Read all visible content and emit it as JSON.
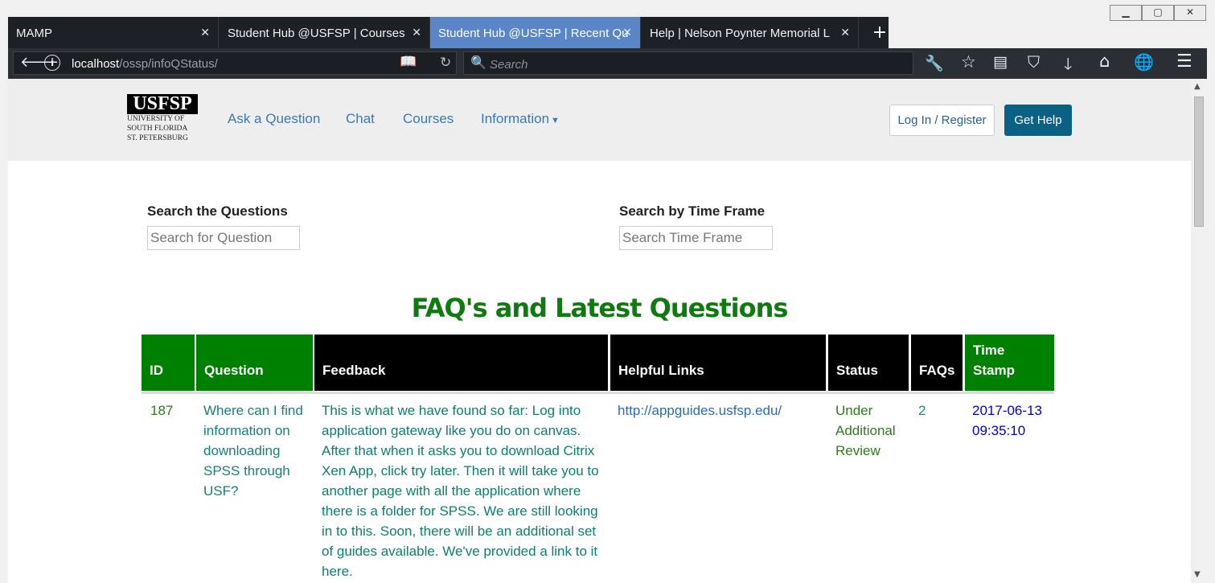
{
  "browser": {
    "tabs": [
      {
        "label": "MAMP"
      },
      {
        "label": "Student Hub @USFSP | Courses"
      },
      {
        "label": "Student Hub @USFSP | Recent Qu"
      },
      {
        "label": "Help | Nelson Poynter Memorial L"
      }
    ],
    "url_host": "localhost",
    "url_path": "/ossp/infoQStatus/",
    "search_placeholder": "Search"
  },
  "site": {
    "logo_mark": "USFSP",
    "logo_lines": [
      "UNIVERSITY OF",
      "SOUTH FLORIDA",
      "ST. PETERSBURG"
    ],
    "nav": [
      "Ask a Question",
      "Chat",
      "Courses",
      "Information"
    ],
    "login_label": "Log In / Register",
    "help_label": "Get Help"
  },
  "search": {
    "questions_label": "Search the Questions",
    "questions_placeholder": "Search for Question",
    "timeframe_label": "Search by Time Frame",
    "timeframe_placeholder": "Search Time Frame"
  },
  "page_title": "FAQ's and Latest Questions",
  "table": {
    "headers": [
      "ID",
      "Question",
      "Feedback",
      "Helpful Links",
      "Status",
      "FAQs",
      "Time Stamp"
    ],
    "rows": [
      {
        "id": "187",
        "question": "Where can I find information on downloading SPSS through USF?",
        "feedback": "This is what we have found so far: Log into application gateway like you do on canvas. After that when it asks you to download Citrix Xen App, click try later. Then it will take you to another page with all the application where there is a folder for SPSS. We are still looking in to this. Soon, there will be an additional set of guides available. We've provided a link to it here.",
        "link": "http://appguides.usfsp.edu/",
        "status": "Under Additional Review",
        "faqs": "2",
        "timestamp": "2017-06-13 09:35:10"
      }
    ]
  },
  "colors": {
    "header_green": "#008000",
    "header_black": "#000000",
    "id_text": "#2e7d1a",
    "question_text": "#18807a",
    "feedback_text": "#0c8070",
    "link_text": "#2a6db4",
    "status_text": "#2e7d1a",
    "faqs_text": "#16857a",
    "timestamp_text": "#0000dd"
  }
}
